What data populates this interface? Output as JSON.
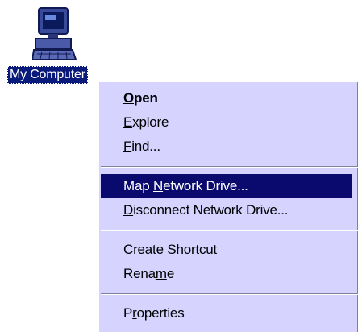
{
  "desktop": {
    "icon": {
      "name": "computer-icon",
      "label": "My Computer"
    }
  },
  "context_menu": {
    "items": [
      {
        "pre": "",
        "key": "O",
        "post": "pen",
        "bold": true
      },
      {
        "pre": "",
        "key": "E",
        "post": "xplore"
      },
      {
        "pre": "",
        "key": "F",
        "post": "ind..."
      },
      {
        "pre": "Map ",
        "key": "N",
        "post": "etwork Drive...",
        "selected": true
      },
      {
        "pre": "",
        "key": "D",
        "post": "isconnect Network Drive..."
      },
      {
        "pre": "Create ",
        "key": "S",
        "post": "hortcut"
      },
      {
        "pre": "Rena",
        "key": "m",
        "post": "e"
      },
      {
        "pre": "P",
        "key": "r",
        "post": "operties"
      }
    ]
  },
  "colors": {
    "selection": "#0a0a6e",
    "menu_background": "#d6d3ff",
    "label_background": "#0a1a7a"
  }
}
